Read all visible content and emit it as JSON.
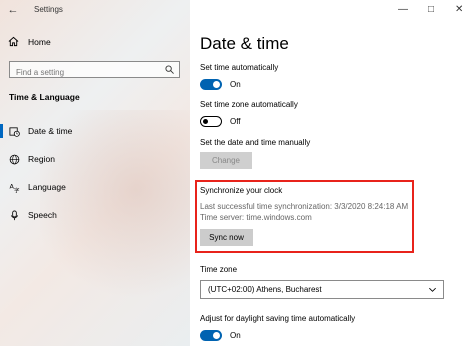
{
  "window": {
    "title": "Settings"
  },
  "sidebar": {
    "home_label": "Home",
    "search_placeholder": "Find a setting",
    "section_title": "Time & Language",
    "items": [
      {
        "label": "Date & time",
        "icon": "calendar-clock-icon",
        "selected": true
      },
      {
        "label": "Region",
        "icon": "globe-icon"
      },
      {
        "label": "Language",
        "icon": "language-icon"
      },
      {
        "label": "Speech",
        "icon": "microphone-icon"
      }
    ]
  },
  "main": {
    "title": "Date & time",
    "set_time_auto": {
      "label": "Set time automatically",
      "state": "On"
    },
    "set_zone_auto": {
      "label": "Set time zone automatically",
      "state": "Off"
    },
    "manual": {
      "label": "Set the date and time manually",
      "button": "Change"
    },
    "sync": {
      "heading": "Synchronize your clock",
      "last_sync": "Last successful time synchronization: 3/3/2020 8:24:18 AM",
      "server": "Time server: time.windows.com",
      "button": "Sync now"
    },
    "time_zone": {
      "label": "Time zone",
      "value": "(UTC+02:00) Athens, Bucharest"
    },
    "dst": {
      "label": "Adjust for daylight saving time automatically",
      "state": "On"
    }
  },
  "colors": {
    "accent": "#0063b1",
    "highlight_border": "#e8231b"
  }
}
